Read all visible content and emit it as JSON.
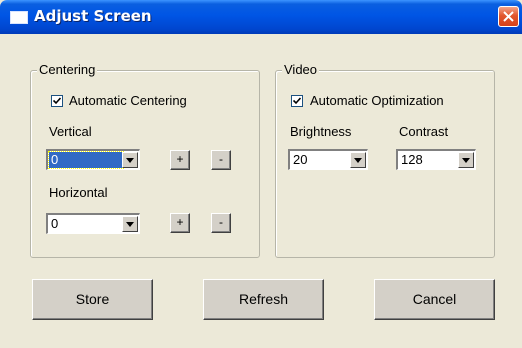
{
  "window": {
    "title": "Adjust Screen"
  },
  "centering": {
    "legend": "Centering",
    "auto_label": "Automatic Centering",
    "auto_checked": true,
    "vertical_label": "Vertical",
    "vertical_value": "0",
    "horizontal_label": "Horizontal",
    "horizontal_value": "0",
    "plus_label": "+",
    "minus_label": "-"
  },
  "video": {
    "legend": "Video",
    "auto_label": "Automatic Optimization",
    "auto_checked": true,
    "brightness_label": "Brightness",
    "brightness_value": "20",
    "contrast_label": "Contrast",
    "contrast_value": "128"
  },
  "buttons": {
    "store": "Store",
    "refresh": "Refresh",
    "cancel": "Cancel"
  },
  "icons": [
    "window-icon",
    "close-icon",
    "checkmark-icon",
    "dropdown-arrow-icon"
  ],
  "colors": {
    "titlebar": "#0055e5",
    "dialog_bg": "#ece9d8",
    "close_button": "#e2572e",
    "selection": "#316ac5"
  }
}
